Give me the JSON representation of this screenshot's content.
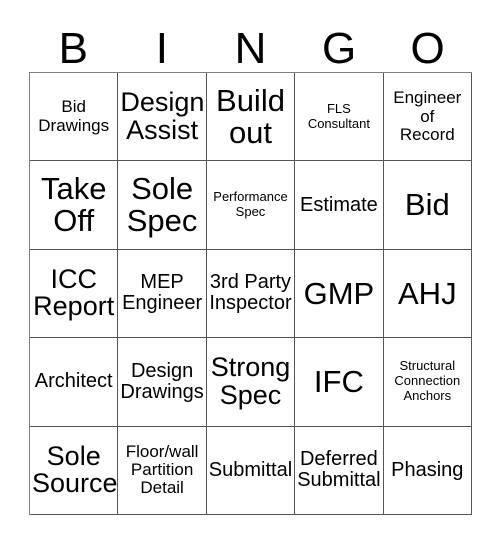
{
  "card": {
    "title": "BINGO",
    "header_letters": [
      "B",
      "I",
      "N",
      "G",
      "O"
    ],
    "grid_size": "5x5",
    "border_color": "#555555",
    "text_color": "#000000",
    "background_color": "#ffffff",
    "rows": [
      [
        {
          "label": "Bid\nDrawings",
          "size": "s-sm"
        },
        {
          "label": "Design\nAssist",
          "size": "s-lg"
        },
        {
          "label": "Build\nout",
          "size": "s-xl"
        },
        {
          "label": "FLS\nConsultant",
          "size": "s-xs"
        },
        {
          "label": "Engineer\nof\nRecord",
          "size": "s-sm"
        }
      ],
      [
        {
          "label": "Take\nOff",
          "size": "s-xl"
        },
        {
          "label": "Sole\nSpec",
          "size": "s-xl"
        },
        {
          "label": "Performance\nSpec",
          "size": "s-xs"
        },
        {
          "label": "Estimate",
          "size": "s-md"
        },
        {
          "label": "Bid",
          "size": "s-xl"
        }
      ],
      [
        {
          "label": "ICC\nReport",
          "size": "s-lg"
        },
        {
          "label": "MEP\nEngineer",
          "size": "s-md"
        },
        {
          "label": "3rd Party\nInspector",
          "size": "s-md"
        },
        {
          "label": "GMP",
          "size": "s-xl"
        },
        {
          "label": "AHJ",
          "size": "s-xl"
        }
      ],
      [
        {
          "label": "Architect",
          "size": "s-md"
        },
        {
          "label": "Design\nDrawings",
          "size": "s-md"
        },
        {
          "label": "Strong\nSpec",
          "size": "s-lg"
        },
        {
          "label": "IFC",
          "size": "s-xl"
        },
        {
          "label": "Structural\nConnection\nAnchors",
          "size": "s-xs"
        }
      ],
      [
        {
          "label": "Sole\nSource",
          "size": "s-lg"
        },
        {
          "label": "Floor/wall\nPartition\nDetail",
          "size": "s-sm"
        },
        {
          "label": "Submittal",
          "size": "s-md"
        },
        {
          "label": "Deferred\nSubmittal",
          "size": "s-md"
        },
        {
          "label": "Phasing",
          "size": "s-md"
        }
      ]
    ]
  }
}
